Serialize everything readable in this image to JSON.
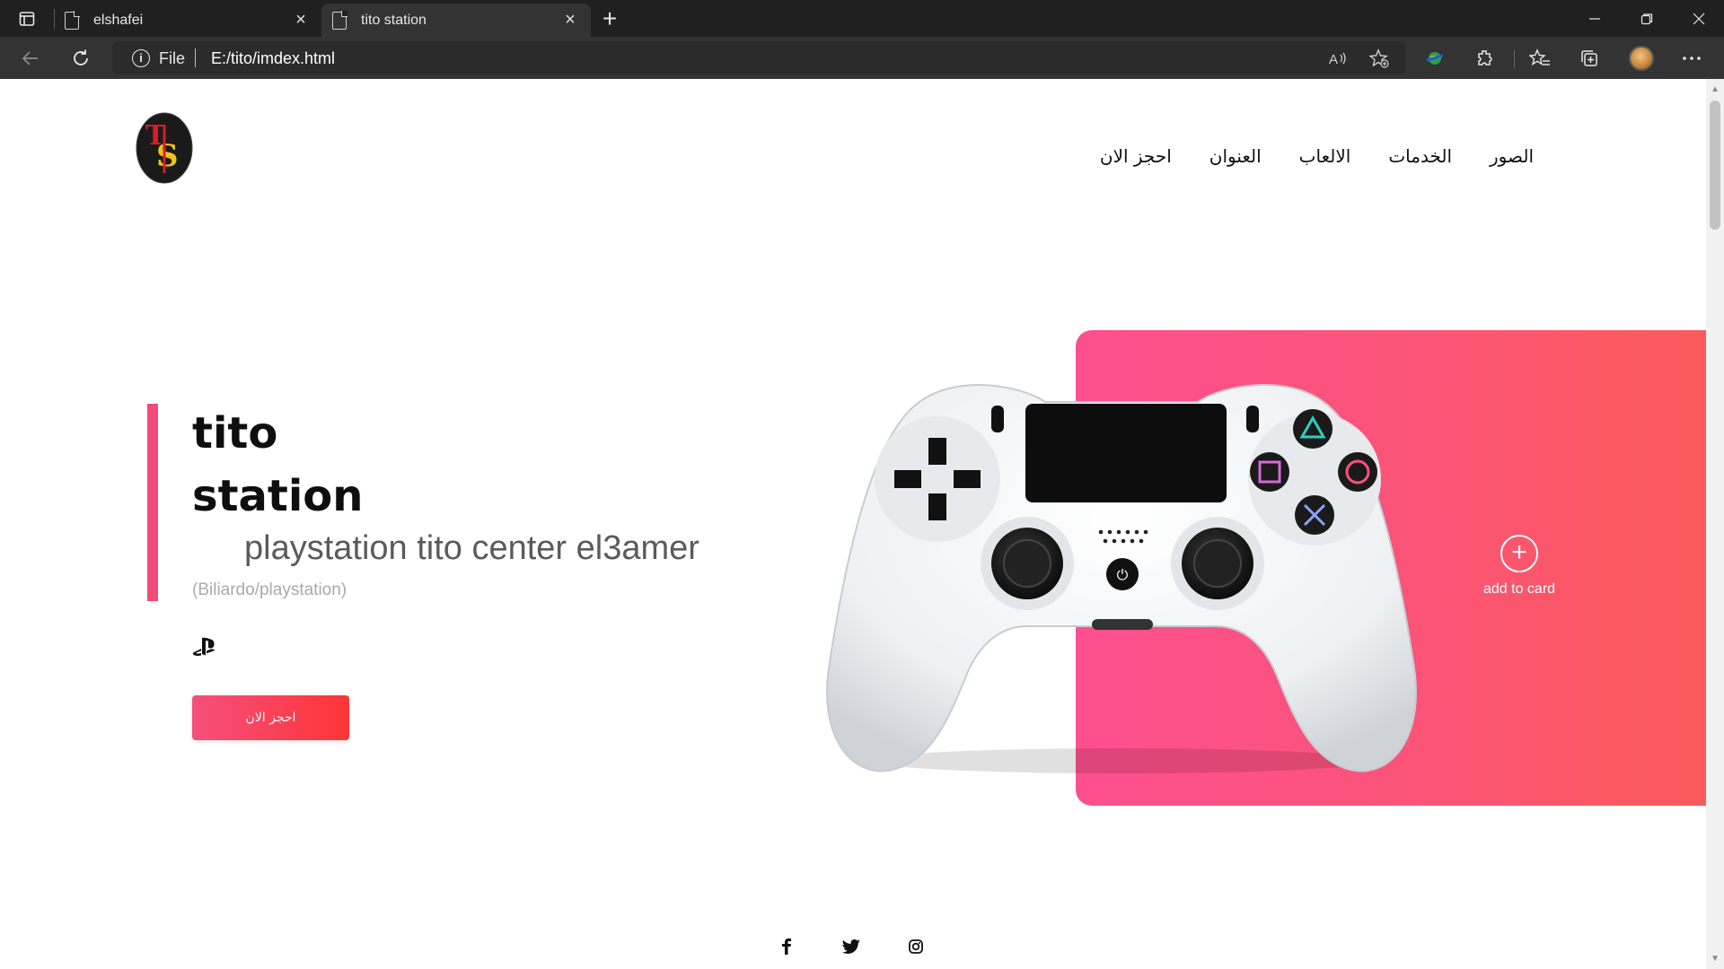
{
  "browser": {
    "tabs": [
      {
        "title": "elshafei",
        "active": false
      },
      {
        "title": "tito station",
        "active": true
      }
    ],
    "address": {
      "scheme_label": "File",
      "url": "E:/tito/imdex.html"
    }
  },
  "page": {
    "nav": {
      "items": [
        "احجز الان",
        "العنوان",
        "الالعاب",
        "الخدمات",
        "الصور"
      ]
    },
    "hero": {
      "title_line1": "tito",
      "title_line2": "station",
      "subtitle": "playstation tito center el3amer",
      "tagline": "(Biliardo/playstation)",
      "cta_label": "احجز الان"
    },
    "card": {
      "add_label": "add to card"
    },
    "socials": [
      "facebook-icon",
      "twitter-icon",
      "instagram-icon"
    ],
    "colors": {
      "accent_pink": "#f24b7a",
      "button_start": "#f54f7e",
      "button_end": "#ff3535",
      "panel_start": "#fd4f8f",
      "panel_end": "#fb5a5a"
    }
  }
}
